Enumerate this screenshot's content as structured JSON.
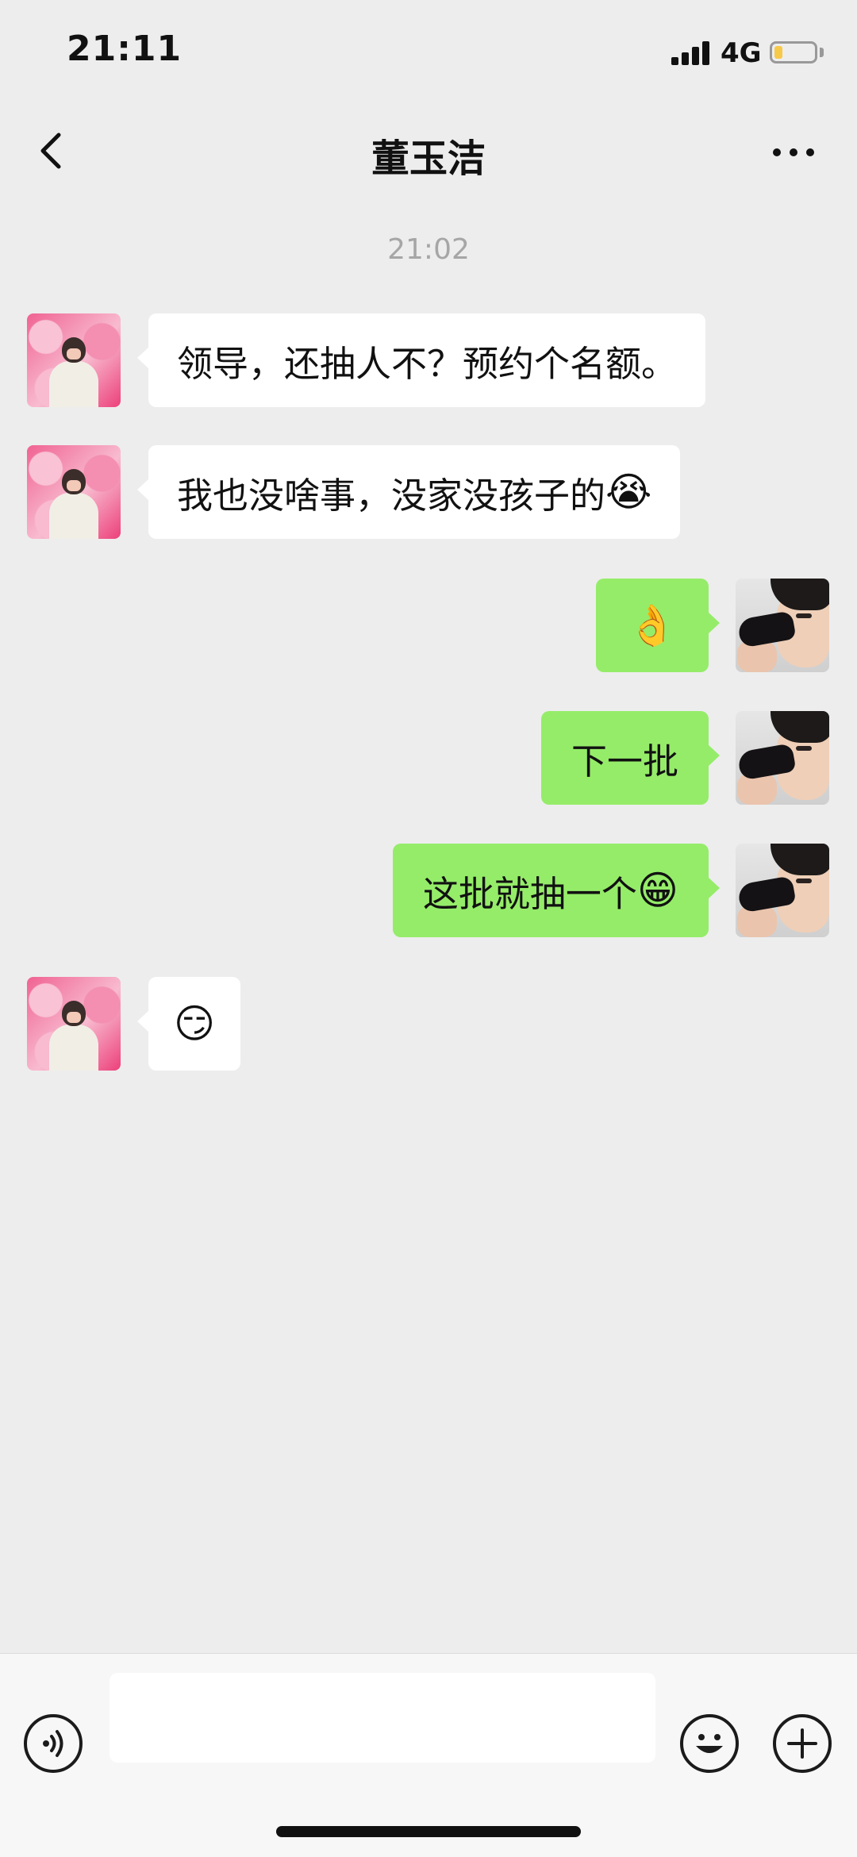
{
  "status_bar": {
    "time": "21:11",
    "network": "4G",
    "battery_level": 0.2
  },
  "nav": {
    "title": "董玉洁",
    "back_icon": "chevron-left-icon",
    "more_icon": "more-dots-icon"
  },
  "chat": {
    "timestamp": "21:02",
    "messages": [
      {
        "side": "left",
        "text": "领导，还抽人不？预约个名额。",
        "emoji": ""
      },
      {
        "side": "left",
        "text": "我也没啥事，没家没孩子的",
        "emoji": "😭"
      },
      {
        "side": "right",
        "text": "",
        "emoji": "👌"
      },
      {
        "side": "right",
        "text": "下一批",
        "emoji": ""
      },
      {
        "side": "right",
        "text": "这批就抽一个",
        "emoji": "😁"
      },
      {
        "side": "left",
        "text": "",
        "emoji": "😏"
      }
    ]
  },
  "input_bar": {
    "voice_icon": "voice-icon",
    "text_value": "",
    "emoji_icon": "smiley-icon",
    "plus_icon": "plus-icon"
  },
  "colors": {
    "background": "#ededed",
    "sent_bubble": "#95ec69",
    "received_bubble": "#ffffff",
    "timestamp_text": "#a6a6a6"
  }
}
